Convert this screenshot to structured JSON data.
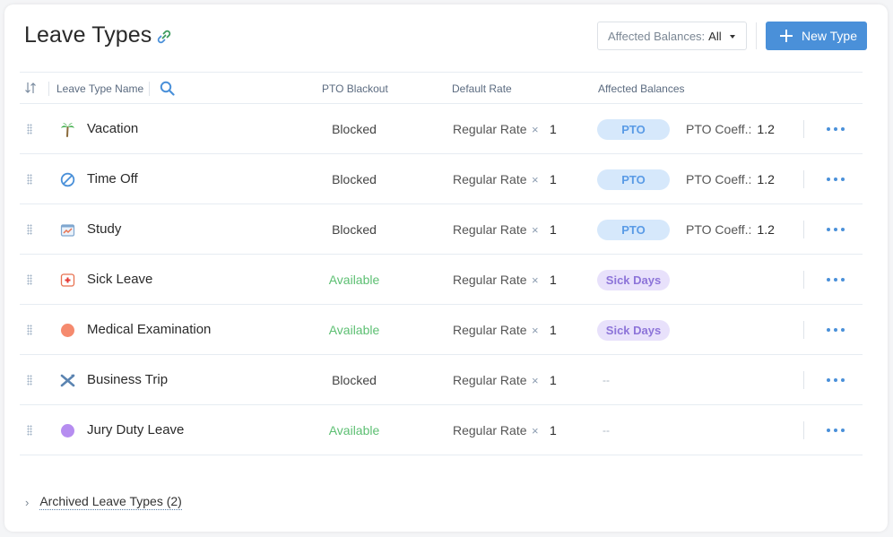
{
  "header": {
    "title": "Leave Types",
    "link_icon": "link-icon",
    "filter": {
      "label": "Affected Balances:",
      "value": "All"
    },
    "new_button_label": "New Type"
  },
  "columns": {
    "sort": "sort-icon",
    "name": "Leave Type Name",
    "search": "search-icon",
    "blackout": "PTO Blackout",
    "rate": "Default Rate",
    "balances": "Affected Balances"
  },
  "rows": [
    {
      "name": "Vacation",
      "icon": "palm-tree-icon",
      "blackout": "Blocked",
      "blackout_status": "blocked",
      "rate": "Regular Rate",
      "times": "×",
      "multiplier": "1",
      "balance": "PTO",
      "balance_kind": "pto",
      "coeff_label": "PTO Coeff.:",
      "coeff": "1.2"
    },
    {
      "name": "Time Off",
      "icon": "no-entry-icon",
      "blackout": "Blocked",
      "blackout_status": "blocked",
      "rate": "Regular Rate",
      "times": "×",
      "multiplier": "1",
      "balance": "PTO",
      "balance_kind": "pto",
      "coeff_label": "PTO Coeff.:",
      "coeff": "1.2"
    },
    {
      "name": "Study",
      "icon": "chart-board-icon",
      "blackout": "Blocked",
      "blackout_status": "blocked",
      "rate": "Regular Rate",
      "times": "×",
      "multiplier": "1",
      "balance": "PTO",
      "balance_kind": "pto",
      "coeff_label": "PTO Coeff.:",
      "coeff": "1.2"
    },
    {
      "name": "Sick Leave",
      "icon": "medical-cross-icon",
      "blackout": "Available",
      "blackout_status": "available",
      "rate": "Regular Rate",
      "times": "×",
      "multiplier": "1",
      "balance": "Sick Days",
      "balance_kind": "sick"
    },
    {
      "name": "Medical Examination",
      "icon": "orange-circle-icon",
      "blackout": "Available",
      "blackout_status": "available",
      "rate": "Regular Rate",
      "times": "×",
      "multiplier": "1",
      "balance": "Sick Days",
      "balance_kind": "sick"
    },
    {
      "name": "Business Trip",
      "icon": "airplane-icon",
      "blackout": "Blocked",
      "blackout_status": "blocked",
      "rate": "Regular Rate",
      "times": "×",
      "multiplier": "1",
      "balance": "--",
      "balance_kind": "none"
    },
    {
      "name": "Jury Duty Leave",
      "icon": "purple-circle-icon",
      "blackout": "Available",
      "blackout_status": "available",
      "rate": "Regular Rate",
      "times": "×",
      "multiplier": "1",
      "balance": "--",
      "balance_kind": "none"
    }
  ],
  "archived": {
    "label": "Archived Leave Types (2)"
  },
  "colors": {
    "accent": "#4a90d9",
    "available": "#5cbf72",
    "pto_pill_bg": "#d6e8fb",
    "sick_pill_bg": "#e8e1fb"
  }
}
